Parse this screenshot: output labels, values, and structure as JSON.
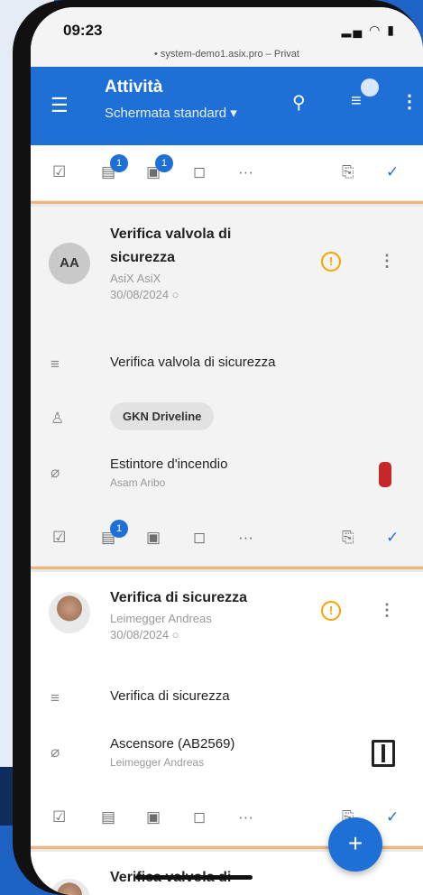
{
  "status": {
    "time": "09:23",
    "icons": "…■",
    "url": "• system-demo1.asix.pro – Privat"
  },
  "appbar": {
    "title": "Attività",
    "subtitle": "Schermata standard ▾",
    "filter_badge": ""
  },
  "toolbar": {
    "badge1": "1",
    "badge2": "1",
    "badge3": "1"
  },
  "cards": [
    {
      "avatar": "AA",
      "title_line1": "Verifica valvola di",
      "title_line2": "sicurezza",
      "person": "AsiX AsiX",
      "date": "30/08/2024 ○",
      "description": "Verifica valvola di sicurezza",
      "chip": "GKN Driveline",
      "object": "Estintore d'incendio",
      "object_sub": "Asam Aribo"
    },
    {
      "title_line1": "Verifica di sicurezza",
      "person": "Leimegger Andreas",
      "date": "30/08/2024 ○",
      "description": "Verifica di sicurezza",
      "object": "Ascensore (AB2569)",
      "object_sub": "Leimegger Andreas"
    },
    {
      "title_line1": "Verifica valvola di"
    }
  ],
  "fab": "+",
  "colors": {
    "accent": "#1e70d6",
    "warning": "#f5a400",
    "separator": "#f0b57a"
  }
}
